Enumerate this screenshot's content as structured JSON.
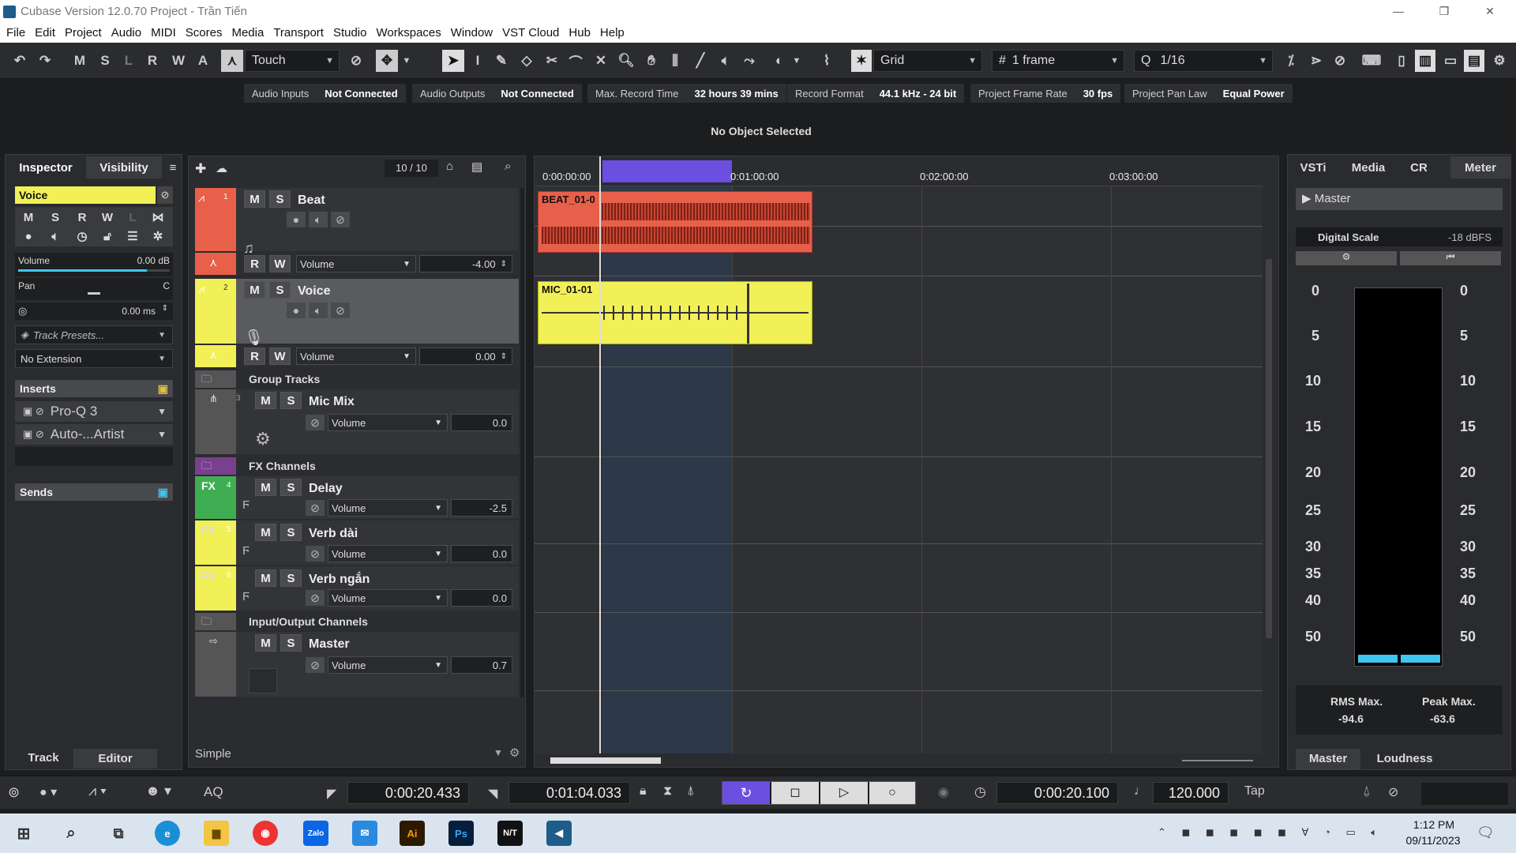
{
  "window": {
    "title": "Cubase Version 12.0.70 Project - Trần Tiến",
    "minimize": "—",
    "restore": "❐",
    "close": "✕"
  },
  "menu": [
    "File",
    "Edit",
    "Project",
    "Audio",
    "MIDI",
    "Scores",
    "Media",
    "Transport",
    "Studio",
    "Workspaces",
    "Window",
    "VST Cloud",
    "Hub",
    "Help"
  ],
  "toolbar": {
    "m": "M",
    "s": "S",
    "l": "L",
    "r": "R",
    "w": "W",
    "a": "A",
    "automation_mode": "Touch",
    "snap_type": "Grid",
    "grid_value": "1 frame",
    "quantize": "1/16"
  },
  "infobar": [
    {
      "key": "Audio Inputs",
      "value": "Not Connected"
    },
    {
      "key": "Audio Outputs",
      "value": "Not Connected"
    },
    {
      "key": "Max. Record Time",
      "value": "32 hours 39 mins"
    },
    {
      "key": "Record Format",
      "value": "44.1 kHz - 24 bit"
    },
    {
      "key": "Project Frame Rate",
      "value": "30 fps"
    },
    {
      "key": "Project Pan Law",
      "value": "Equal Power"
    }
  ],
  "status": "No Object Selected",
  "inspector": {
    "tabs": {
      "inspector": "Inspector",
      "visibility": "Visibility"
    },
    "track_name": "Voice",
    "btns": {
      "m": "M",
      "s": "S",
      "r": "R",
      "w": "W",
      "l": "L"
    },
    "volume_label": "Volume",
    "volume_value": "0.00 dB",
    "volume_level": 0.85,
    "pan_label": "Pan",
    "pan_value": "C",
    "delay_value": "0.00 ms",
    "track_presets": "Track Presets...",
    "extension": "No Extension",
    "inserts_label": "Inserts",
    "inserts": [
      "Pro-Q 3",
      "Auto-...Artist"
    ],
    "sends_label": "Sends",
    "bottom_tabs": {
      "track": "Track",
      "editor": "Editor"
    }
  },
  "tracklist": {
    "counter": "10 / 10",
    "footer": "Simple",
    "m": "M",
    "s": "S",
    "r": "R",
    "w": "W",
    "fx": "FX",
    "vol_label": "Volume",
    "beat": {
      "num": "1",
      "name": "Beat",
      "auto_value": "-4.00"
    },
    "voice": {
      "num": "2",
      "name": "Voice",
      "auto_value": "0.00"
    },
    "group_folder": "Group Tracks",
    "micmix": {
      "num": "3",
      "name": "Mic Mix",
      "value": "0.0"
    },
    "fx_folder": "FX Channels",
    "delay": {
      "num": "4",
      "name": "Delay",
      "value": "-2.5"
    },
    "verbdai": {
      "num": "5",
      "name": "Verb dài",
      "value": "0.0"
    },
    "verbngan": {
      "num": "6",
      "name": "Verb ngắn",
      "value": "0.0"
    },
    "io_folder": "Input/Output Channels",
    "master": {
      "name": "Master",
      "value": "0.7"
    }
  },
  "ruler": [
    "0:00:00:00",
    "0:01:00:00",
    "0:02:00:00",
    "0:03:00:00"
  ],
  "clips": {
    "beat": "BEAT_01-0",
    "mic": "MIC_01-01"
  },
  "right": {
    "tabs": {
      "vsti": "VSTi",
      "media": "Media",
      "cr": "CR",
      "meter": "Meter"
    },
    "master": "Master",
    "digital_scale": "Digital Scale",
    "dbfs": "-18 dBFS",
    "scale": [
      "0",
      "5",
      "10",
      "15",
      "20",
      "25",
      "30",
      "35",
      "40",
      "50"
    ],
    "rms_label": "RMS Max.",
    "rms_value": "-94.6",
    "peak_label": "Peak Max.",
    "peak_value": "-63.6",
    "bottom_tabs": {
      "master": "Master",
      "loudness": "Loudness"
    }
  },
  "transport": {
    "aq": "AQ",
    "left_locator": "0:00:20.433",
    "right_locator": "0:01:04.033",
    "position": "0:00:20.100",
    "tempo": "120.000",
    "tap": "Tap"
  },
  "taskbar": {
    "zalo": "Zalo",
    "ai": "Ai",
    "ps": "Ps",
    "nt": "N/T",
    "time": "1:12 PM",
    "date": "09/11/2023"
  },
  "colors": {
    "beat": "#e8604a",
    "voice": "#f2f057",
    "fx_green": "#3fae52",
    "folder_purple": "#7a3f8f",
    "loop": "#6b4fe0",
    "meter_fill": "#3ec6f0"
  }
}
